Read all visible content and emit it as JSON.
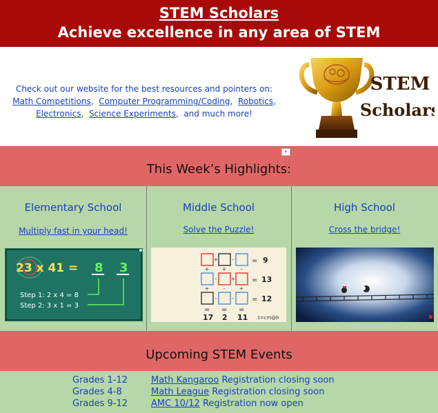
{
  "header": {
    "title": "STEM Scholars",
    "subtitle": "Achieve excellence in any area of STEM"
  },
  "intro": {
    "lead": "Check out our website for the best resources and pointers on:",
    "links": [
      "Math Competitions",
      "Computer Programming/Coding",
      "Robotics",
      "Electronics",
      "Science Experiments"
    ],
    "tail": "and much more!"
  },
  "logo": {
    "line1": "STEM",
    "line2": "Scholars"
  },
  "highlights": {
    "title": "This Week’s Highlights:",
    "columns": [
      {
        "heading": "Elementary School",
        "link": "Multiply fast in your head!"
      },
      {
        "heading": "Middle School",
        "link": "Solve the Puzzle!"
      },
      {
        "heading": "High School",
        "link": "Cross the bridge!"
      }
    ]
  },
  "mult_image": {
    "equation_left": "23 x 41 =",
    "digit1": "8",
    "digit2": "3",
    "step1": "Step 1: 2 x 4 = 8",
    "step2": "Step 2: 3 x 1 = 3"
  },
  "puzzle_image": {
    "row_results": [
      "9",
      "13",
      "12"
    ],
    "col_results": [
      "17",
      "2",
      "11"
    ],
    "brand": "t=cm@h"
  },
  "events": {
    "title": "Upcoming STEM Events",
    "rows": [
      {
        "grades": "Grades 1-12",
        "name": "Math Kangaroo",
        "status": "Registration closing soon"
      },
      {
        "grades": "Grades 4-8",
        "name": "Math League",
        "status": "Registration closing soon"
      },
      {
        "grades": "Grades 9-12",
        "name": "AMC 10/12",
        "status": "Registration now open"
      }
    ]
  },
  "colors": {
    "header_bg": "#a80a0a",
    "band_bg": "#e06666",
    "panel_bg": "#b6d7a8",
    "link": "#1a3fbf"
  }
}
